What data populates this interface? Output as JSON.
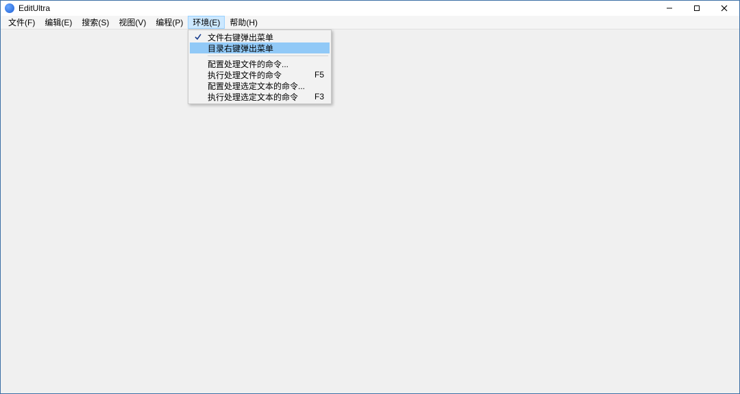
{
  "window": {
    "title": "EditUltra"
  },
  "menubar": {
    "items": [
      {
        "label": "文件(F)"
      },
      {
        "label": "编辑(E)"
      },
      {
        "label": "搜索(S)"
      },
      {
        "label": "视图(V)"
      },
      {
        "label": "编程(P)"
      },
      {
        "label": "环境(E)"
      },
      {
        "label": "帮助(H)"
      }
    ]
  },
  "popup": {
    "items": {
      "file_context": {
        "label": "文件右键弹出菜单",
        "checked": true
      },
      "dir_context": {
        "label": "目录右键弹出菜单"
      },
      "config_file_cmd": {
        "label": "配置处理文件的命令..."
      },
      "run_file_cmd": {
        "label": "执行处理文件的命令",
        "shortcut": "F5"
      },
      "config_sel_cmd": {
        "label": "配置处理选定文本的命令..."
      },
      "run_sel_cmd": {
        "label": "执行处理选定文本的命令",
        "shortcut": "F3"
      }
    }
  }
}
